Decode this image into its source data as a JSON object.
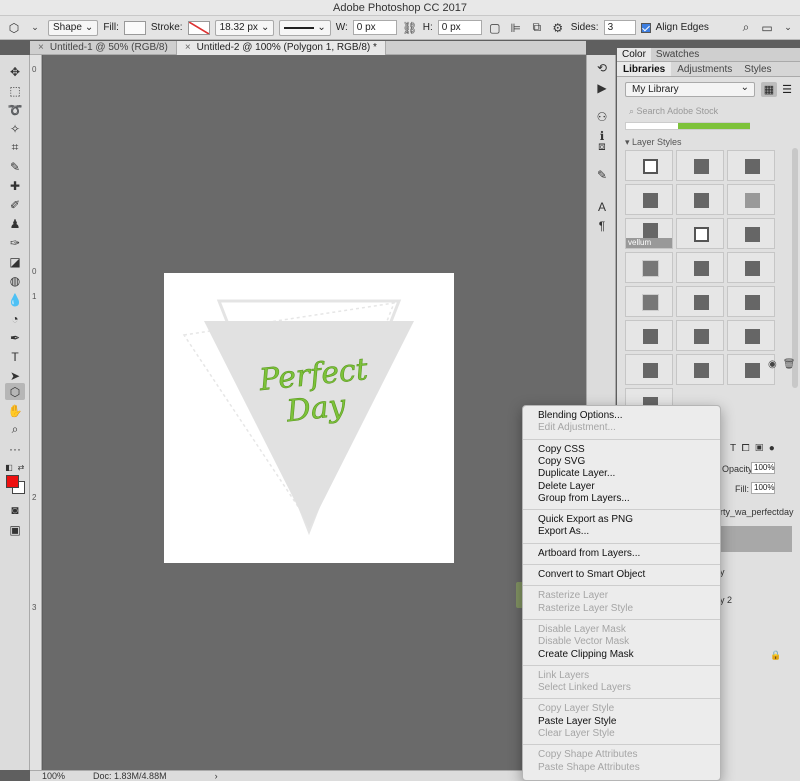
{
  "window": {
    "title": "Adobe Photoshop CC 2017"
  },
  "options_bar": {
    "mode": "Shape",
    "fill_label": "Fill:",
    "stroke_label": "Stroke:",
    "stroke_width": "18.32 px",
    "w_label": "W:",
    "w_value": "0 px",
    "h_label": "H:",
    "h_value": "0 px",
    "sides_label": "Sides:",
    "sides_value": "3",
    "align_edges": "Align Edges"
  },
  "tabs": [
    {
      "label": "Untitled-1 @ 50% (RGB/8)",
      "close": "×"
    },
    {
      "label": "Untitled-2 @ 100% (Polygon 1, RGB/8) *",
      "close": "×"
    }
  ],
  "ruler_marks": [
    "0",
    "1",
    "2",
    "3"
  ],
  "artwork": {
    "line1": "Perfect",
    "line2": "Day",
    "colors": {
      "triangle": "#e0e0e0",
      "lettering": "#7dc23a",
      "lines": "#e2e2e2"
    }
  },
  "status": {
    "zoom": "100%",
    "doc": "Doc: 1.83M/4.88M",
    "arrow": "›"
  },
  "panels": {
    "tabs_top": [
      "Color",
      "Swatches"
    ],
    "tabs_main": [
      "Libraries",
      "Adjustments",
      "Styles"
    ],
    "library": "My Library",
    "search_placeholder": "Search Adobe Stock",
    "layer_styles_header": "▾ Layer Styles",
    "style_label": "vellum"
  },
  "layers_panel": {
    "opacity_label": "Opacity:",
    "opacity_value": "100%",
    "fill_label": "Fill:",
    "fill_value": "100%",
    "row1": "rty_wa_perfectday",
    "row2": "y",
    "row3": "y 2"
  },
  "context_menu": {
    "groups": [
      [
        {
          "label": "Blending Options...",
          "disabled": false
        },
        {
          "label": "Edit Adjustment...",
          "disabled": true
        }
      ],
      [
        {
          "label": "Copy CSS",
          "disabled": false
        },
        {
          "label": "Copy SVG",
          "disabled": false
        },
        {
          "label": "Duplicate Layer...",
          "disabled": false
        },
        {
          "label": "Delete Layer",
          "disabled": false
        },
        {
          "label": "Group from Layers...",
          "disabled": false
        }
      ],
      [
        {
          "label": "Quick Export as PNG",
          "disabled": false
        },
        {
          "label": "Export As...",
          "disabled": false
        }
      ],
      [
        {
          "label": "Artboard from Layers...",
          "disabled": false
        }
      ],
      [
        {
          "label": "Convert to Smart Object",
          "disabled": false
        }
      ],
      [
        {
          "label": "Rasterize Layer",
          "disabled": true
        },
        {
          "label": "Rasterize Layer Style",
          "disabled": true
        }
      ],
      [
        {
          "label": "Disable Layer Mask",
          "disabled": true
        },
        {
          "label": "Disable Vector Mask",
          "disabled": true
        },
        {
          "label": "Create Clipping Mask",
          "disabled": false
        }
      ],
      [
        {
          "label": "Link Layers",
          "disabled": true
        },
        {
          "label": "Select Linked Layers",
          "disabled": true
        }
      ],
      [
        {
          "label": "Copy Layer Style",
          "disabled": true
        },
        {
          "label": "Paste Layer Style",
          "disabled": false
        },
        {
          "label": "Clear Layer Style",
          "disabled": true
        }
      ],
      [
        {
          "label": "Copy Shape Attributes",
          "disabled": true
        },
        {
          "label": "Paste Shape Attributes",
          "disabled": true
        }
      ]
    ]
  }
}
